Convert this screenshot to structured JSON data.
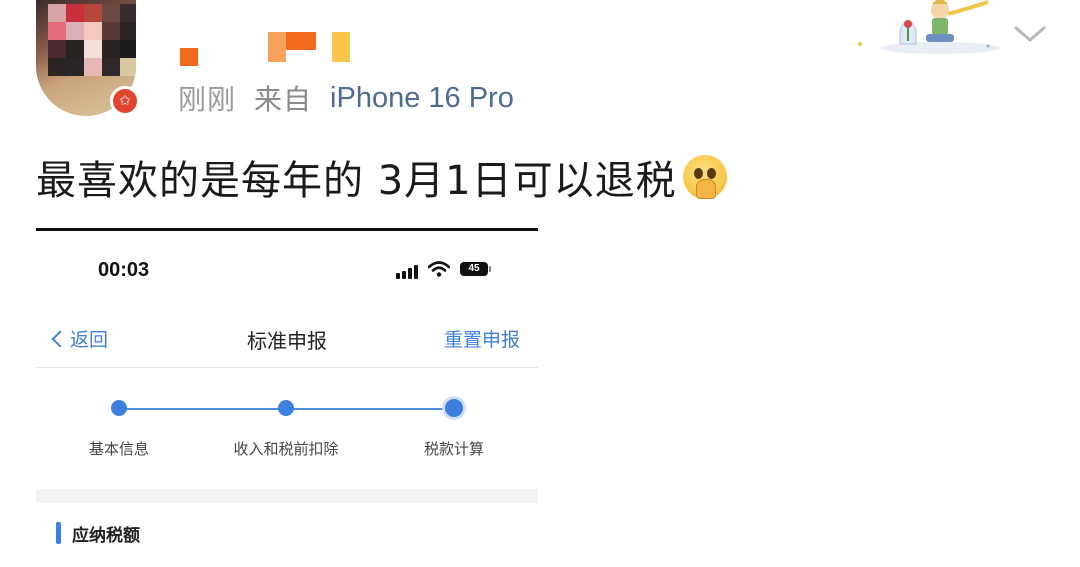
{
  "post": {
    "time": "刚刚",
    "source_prefix": "来自",
    "device": "iPhone 16 Pro",
    "text": "最喜欢的是每年的 3月1日可以退税"
  },
  "icons": {
    "avatar": "avatar",
    "badge": "star-badge-icon",
    "emoji": "pleading-face-hands-emoji",
    "more": "chevron-down-icon"
  },
  "screenshot": {
    "status_time": "00:03",
    "battery_level": "45",
    "nav": {
      "back_label": "返回",
      "title": "标准申报",
      "reset_label": "重置申报"
    },
    "steps": [
      {
        "label": "基本信息"
      },
      {
        "label": "收入和税前扣除"
      },
      {
        "label": "税款计算"
      }
    ],
    "current_step": 3,
    "section_title": "应纳税额"
  },
  "colors": {
    "link_blue": "#3f7fd8",
    "step_blue": "#3d7fde",
    "badge_red": "#e0452f",
    "device_blue": "#4d6b94"
  }
}
